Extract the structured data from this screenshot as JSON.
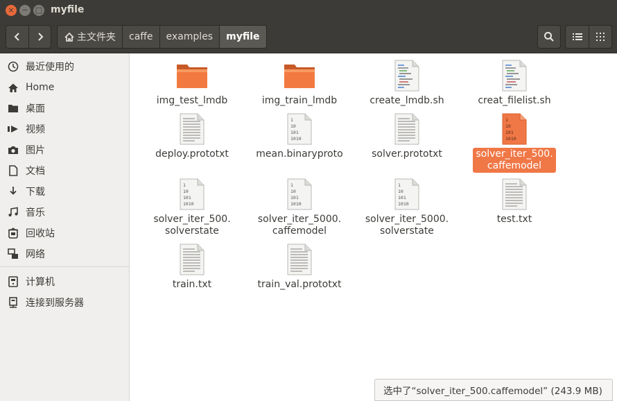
{
  "window": {
    "title": "myfile",
    "controls": {
      "close": "×",
      "minimize": "−",
      "maximize": "□"
    }
  },
  "toolbar": {
    "back_icon": "chevron-left-icon",
    "forward_icon": "chevron-right-icon",
    "breadcrumbs": [
      "主文件夹",
      "caffe",
      "examples",
      "myfile"
    ],
    "search_icon": "search-icon",
    "view_list_icon": "list-view-icon",
    "view_grid_icon": "grid-view-icon"
  },
  "sidebar": {
    "items": [
      {
        "label": "最近使用的",
        "icon": "clock-icon"
      },
      {
        "label": "Home",
        "icon": "home-icon"
      },
      {
        "label": "桌面",
        "icon": "desktop-folder-icon"
      },
      {
        "label": "视频",
        "icon": "video-icon"
      },
      {
        "label": "图片",
        "icon": "camera-icon"
      },
      {
        "label": "文档",
        "icon": "document-icon"
      },
      {
        "label": "下载",
        "icon": "download-icon"
      },
      {
        "label": "音乐",
        "icon": "music-icon"
      },
      {
        "label": "回收站",
        "icon": "trash-icon"
      },
      {
        "label": "网络",
        "icon": "network-icon"
      },
      {
        "label": "计算机",
        "icon": "computer-icon"
      },
      {
        "label": "连接到服务器",
        "icon": "server-icon"
      }
    ]
  },
  "files": [
    {
      "name": "img_test_lmdb",
      "type": "folder"
    },
    {
      "name": "img_train_lmdb",
      "type": "folder"
    },
    {
      "name": "create_lmdb.sh",
      "type": "script"
    },
    {
      "name": "creat_filelist.sh",
      "type": "script"
    },
    {
      "name": "deploy.prototxt",
      "type": "text"
    },
    {
      "name": "mean.binaryproto",
      "type": "binary"
    },
    {
      "name": "solver.prototxt",
      "type": "text"
    },
    {
      "name": "solver_iter_500.\ncaffemodel",
      "type": "binary",
      "selected": true
    },
    {
      "name": "solver_iter_500.\nsolverstate",
      "type": "binary"
    },
    {
      "name": "solver_iter_5000.\ncaffemodel",
      "type": "binary"
    },
    {
      "name": "solver_iter_5000.\nsolverstate",
      "type": "binary"
    },
    {
      "name": "test.txt",
      "type": "text"
    },
    {
      "name": "train.txt",
      "type": "text"
    },
    {
      "name": "train_val.prototxt",
      "type": "text"
    }
  ],
  "binary_glyph": [
    "1",
    "10",
    "101",
    "1010"
  ],
  "status": {
    "text": "选中了“solver_iter_500.caffemodel” (243.9 MB)"
  },
  "colors": {
    "accent": "#f07746",
    "folder": "#f0743e",
    "titlebar": "#3c3b37"
  }
}
